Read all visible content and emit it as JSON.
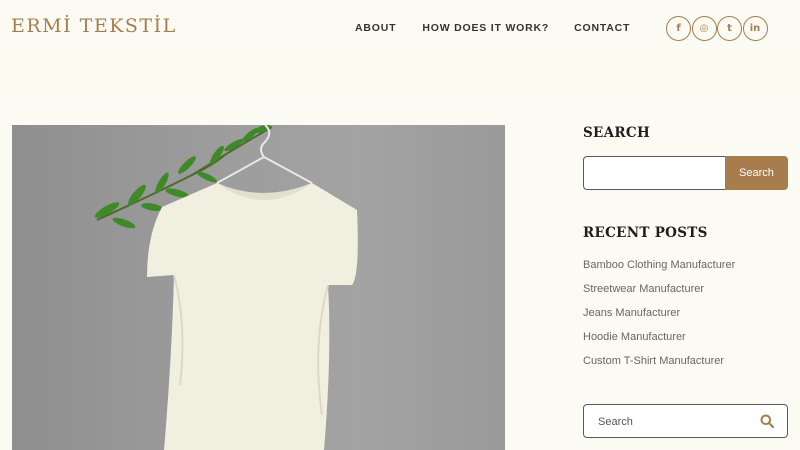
{
  "header": {
    "logo": "ERMİ TEKSTİL",
    "nav": [
      "ABOUT",
      "HOW DOES IT WORK?",
      "CONTACT"
    ],
    "social": [
      {
        "name": "facebook-icon",
        "glyph": "f"
      },
      {
        "name": "instagram-icon",
        "glyph": "◎"
      },
      {
        "name": "twitter-icon",
        "glyph": "t"
      },
      {
        "name": "linkedin-icon",
        "glyph": "in"
      }
    ]
  },
  "sidebar": {
    "search_title": "SEARCH",
    "search_button": "Search",
    "recent_title": "RECENT POSTS",
    "posts": [
      "Bamboo Clothing Manufacturer",
      "Streetwear Manufacturer",
      "Jeans Manufacturer",
      "Hoodie Manufacturer",
      "Custom T-Shirt Manufacturer"
    ],
    "search2_placeholder": "Search"
  },
  "colors": {
    "accent": "#a77d4e",
    "background": "#fcfbf3"
  }
}
